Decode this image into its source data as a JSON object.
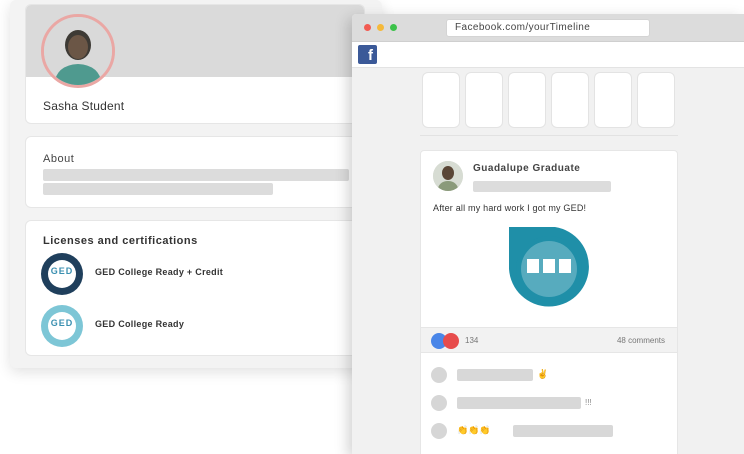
{
  "profile": {
    "name": "Sasha Student",
    "about_title": "About",
    "licenses_title": "Licenses and certifications",
    "licenses": [
      {
        "label": "GED College Ready + Credit",
        "badge_text": "GED",
        "ring_color": "#1f3f5c"
      },
      {
        "label": "GED College Ready",
        "badge_text": "GED",
        "ring_color": "#7dc6d6"
      }
    ]
  },
  "browser": {
    "url": "Facebook.com/yourTimeline",
    "logo": "f",
    "post": {
      "author": "Guadalupe Graduate",
      "text": "After all my hard work I got my GED!",
      "badge_text": "GED",
      "reaction_count": "134",
      "comments": "48 comments",
      "comment_emojis": [
        "✌",
        "👏👏👏"
      ],
      "comment_suffix": "!!!"
    }
  },
  "colors": {
    "facebook_blue": "#3b5998",
    "ged_teal": "#1f8fa8",
    "avatar_ring": "#eaa7a4",
    "like_blue": "#4a86e8",
    "love_red": "#e74c4c"
  },
  "icons": {
    "like": "like-icon",
    "love": "love-icon",
    "facebook": "facebook-logo-icon"
  }
}
